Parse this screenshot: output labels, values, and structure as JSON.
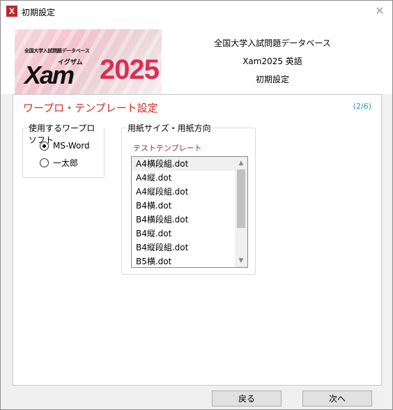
{
  "window": {
    "title": "初期設定",
    "close_symbol": "✕",
    "icon_letter": "X"
  },
  "header": {
    "banner": {
      "line_small": "全国大学入試問題データベース",
      "kana": "イグザム",
      "brand": "Xam",
      "year": "2025"
    },
    "lines": [
      "全国大学入試問題データベース",
      "Xam2025 英語",
      "初期設定"
    ]
  },
  "panel": {
    "title": "ワープロ・テンプレート設定",
    "step": "(2/6)",
    "software_group": {
      "legend": "使用するワープロソフト",
      "options": [
        {
          "label": "MS-Word",
          "checked": true
        },
        {
          "label": "一太郎",
          "checked": false
        }
      ]
    },
    "paper_group": {
      "legend": "用紙サイズ・用紙方向",
      "template_label": "テストテンプレート",
      "items": [
        "A4横段組.dot",
        "A4縦.dot",
        "A4縦段組.dot",
        "B4横.dot",
        "B4横段組.dot",
        "B4縦.dot",
        "B4縦段組.dot",
        "B5横.dot"
      ],
      "selected_index": 0
    }
  },
  "buttons": {
    "back": "戻る",
    "next": "次へ"
  },
  "colors": {
    "title_red": "#d42a1e",
    "step_blue": "#2c8fd6",
    "banner_red": "#d92f54"
  },
  "icons": {
    "app": "xam-app-icon",
    "close": "close-icon",
    "scroll_up": "chevron-up-icon",
    "scroll_down": "chevron-down-icon"
  }
}
